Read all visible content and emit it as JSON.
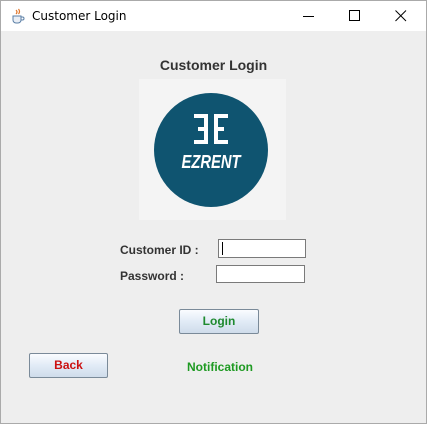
{
  "window": {
    "title": "Customer Login",
    "icon": "java-cup-icon",
    "controls": [
      "minimize-icon",
      "maximize-icon",
      "close-icon"
    ]
  },
  "form": {
    "heading": "Customer Login",
    "logo": {
      "text": "EZRENT",
      "mark": "EE-monogram",
      "circle_color": "#0f5470"
    },
    "customer_id_label": "Customer ID :",
    "customer_id_value": "",
    "password_label": "Password :",
    "password_value": "",
    "login_label": "Login",
    "back_label": "Back",
    "notification": "Notification"
  },
  "colors": {
    "login_text": "#1e8a2f",
    "back_text": "#cc1111",
    "notification_text": "#1e9a22"
  }
}
